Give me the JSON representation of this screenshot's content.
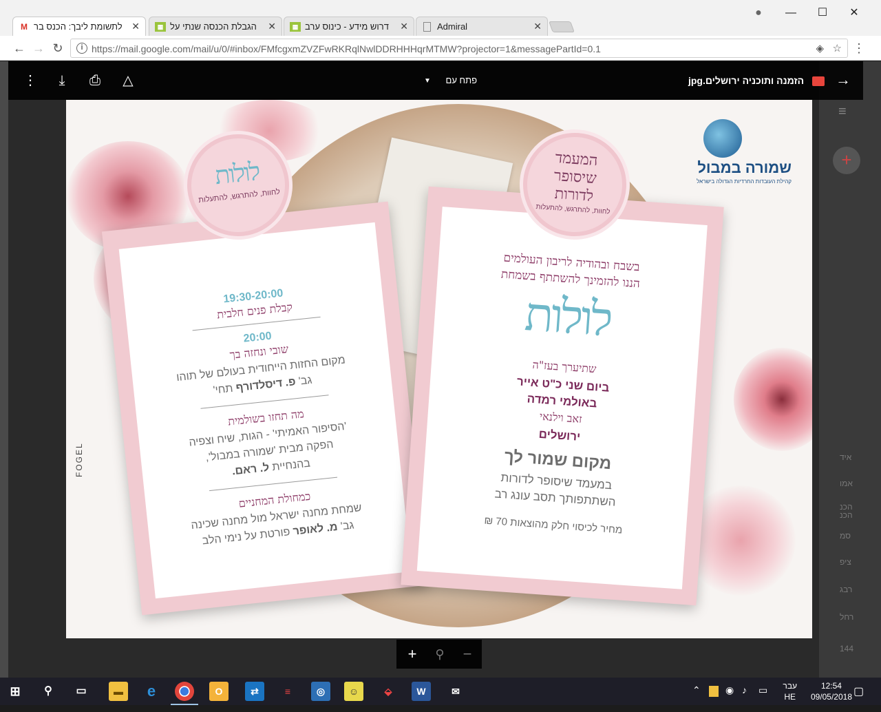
{
  "browser": {
    "tabs": [
      {
        "title": "לתשומת ליבך: הכנס בר",
        "favicon": "gmail-icon",
        "active": true
      },
      {
        "title": "הגבלת הכנסה שנתי על",
        "favicon": "sheet-icon",
        "active": false
      },
      {
        "title": "דרוש מידע - כינוס ערב",
        "favicon": "sheet-icon",
        "active": false
      },
      {
        "title": "Admiral",
        "favicon": "page-icon",
        "active": false
      }
    ],
    "url_host": "https://mail.google.com",
    "url_path": "/mail/u/0/#inbox/FMfcgxmZVZFwRKRqlNwlDDRHHHqrMTMW?projector=1&messagePartId=0.1"
  },
  "viewer": {
    "file_name": "הזמנה ותוכניה ירושלים.jpg",
    "open_with": "פתח עם"
  },
  "invitation": {
    "left_card": {
      "medallion_title": "לולות",
      "medallion_sub": "לחוות, להתרגש, להתעלות",
      "time1": "19:30-20:00",
      "line1": "קבלת פנים חלבית",
      "time2": "20:00",
      "heading2": "שובי ונחזה בך",
      "line2a": "מקום החזות הייחודית בעולם של תוהו",
      "line2b_prefix": "גב'",
      "line2b_name": "פ. דיסלדורף",
      "line2b_suffix": "תחי'",
      "heading3": "מה תחזו בשולמית",
      "line3a": "'הסיפור האמיתי' - הגות, שיח וצפיה",
      "line3b": "הפקה מבית 'שמורה במבול',",
      "line3c_prefix": "בהנחיית",
      "line3c_name": "ל. ראם.",
      "heading4": "כמחולת המחניים",
      "line4a": "שמחת מחנה ישראל מול מחנה שכינה",
      "line4b_prefix": "גב'",
      "line4b_name": "מ. לאופר",
      "line4b_suffix": "פורטת על נימי הלב"
    },
    "right_card": {
      "medallion_line1": "המעמד",
      "medallion_line2": "שיסופר",
      "medallion_line3": "לדורות",
      "medallion_sub": "לחוות, להתרגש, להתעלות",
      "intro1": "בשבח ובהודיה לריבון העולמים",
      "intro2": "הננו להזמינך להשתתף בשמחת",
      "script_title": "לולות",
      "when1": "שתיערך בעז\"ה",
      "when2": "ביום שני כ\"ט אייר",
      "venue": "באולמי רמדה",
      "street": "זאב וילנאי",
      "city": "ירושלים",
      "heading": "מקום שמור לך",
      "sub1": "במעמד שיסופר לדורות",
      "sub2": "השתתפותך תסב עונג רב",
      "price": "מחיר לכיסוי חלק מהוצאות 70 ₪"
    },
    "logo_name": "שמורה במבול",
    "logo_tagline": "קהילת העובדות החרדיות הגדולה בישראל",
    "credit": "FOGEL"
  },
  "gmail_sidebar": [
    "איד",
    "אמו",
    "הכנ",
    "הכנ",
    "סמ",
    "ציפ",
    "רבג",
    "רחל",
    "144"
  ],
  "taskbar": {
    "lang_line1": "עבר",
    "lang_line2": "HE",
    "time": "12:54",
    "date": "09/05/2018"
  },
  "colors": {
    "teal_script": "#6fb8c9",
    "plum": "#8c3a66",
    "card_border": "#f1cbd1",
    "logo_blue": "#1d4f83"
  }
}
